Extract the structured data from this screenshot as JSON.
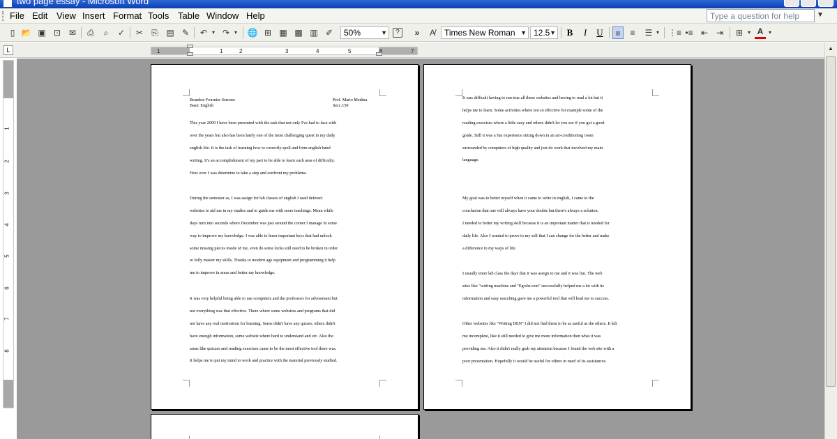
{
  "window": {
    "title": "two page essay - Microsoft Word"
  },
  "menubar": {
    "items": [
      "File",
      "Edit",
      "View",
      "Insert",
      "Format",
      "Tools",
      "Table",
      "Window",
      "Help"
    ],
    "ask_placeholder": "Type a question for help"
  },
  "toolbar": {
    "zoom": "50%",
    "font": "Times New Roman",
    "size": "12.5",
    "bold": "B",
    "italic": "I",
    "underline": "U",
    "font_color": "A",
    "help_glyph": "?",
    "overflow": "»",
    "colors": {
      "font_color_underline": "#e00000"
    }
  },
  "ruler": {
    "tab_selector": "L",
    "h_ticks": [
      "1",
      "1",
      "2",
      "3",
      "4",
      "5",
      "6",
      "7"
    ],
    "v_ticks": [
      "1",
      "2",
      "3",
      "4",
      "5",
      "6",
      "7",
      "8"
    ]
  },
  "page1": {
    "name_left": "Brandon Fournier Serrano",
    "course_left": "Basic English",
    "name_right": "Prof. Mario Medina",
    "course_right": "Secc.150",
    "p1": [
      " This year 2009 I have been presented with the task that not only I've had to face with",
      "over the years but also has been lately one of the most challenging  quest  in my daily",
      "english life. It is the task of learning how to correctly spell and form english hand",
      "writing. It's an accomplishment of my part to be able to learn such area of difficulty.",
      "How ever I was determine to take a step and confront my problems."
    ],
    "p2": [
      " During the semester as, I was assign for lab classes of english I used deferect",
      "websites to aid me in my studies and to guide me with more teachings. Mean while",
      "days turn into seconds where December was just around the corner I manage in some",
      "way to improve my knowledge. I was able to learn important keys that had unlock",
      "some missing pieces inside of me, even do some locks still need to be broken in order",
      "to fully master my skills. Thanks to modern age equipment and programming it help",
      "me to improve in areas and better my knowledge."
    ],
    "p3": [
      " It was very helpful being able to use computers and the professors for advisement but",
      "not everything was that effective. There where some websites and programs that did",
      "not have any real motivation for learning. Some didn't have any quizes; others didn't",
      "have enough information, some website where hard to understand and etc. Also  the",
      "areas like quizzes and reading exercises came to be the most effective tool there was.",
      "It helps me to put my mind to work and practice with the material previously studied."
    ]
  },
  "page2": {
    "p1": [
      " It was difficult having to run true all these websites and having to read a lot but it",
      "helps me to learn. Some activities where not so effective for example some of the",
      "reading exercises where a little easy and others didn't let you see if you got a good",
      "grade. Still it was a fun experience sitting down in an air-conditioning room",
      "surrounded by computers of high quality and just do work that involved my main",
      "language."
    ],
    "p2": [
      "My goal was to better myself when it came to write in english, I came to the",
      "conclusion that one will always have your doubts but there's always a solution.",
      "I needed to better my writing skill because it is an  important matter that is needed for",
      "daily life. Also I wanted to prove to my self that I can change for the better and make",
      "a difference to my ways of life."
    ],
    "p3": [
      " I usually enter lab class the days that it was assign to me and it was fun. The web",
      "sites like \"writing machine and \"Ego4u.com\" successfully helped me a lot with its",
      "information and easy searching gave me a powerful tool that will lead me to success."
    ],
    "p4": [
      "Other websites like \"Writing DEN\" I did not find them to be as useful as the others. It left",
      "me incomplete, like it still needed to give me more information then what it was",
      "providing me. Also it didn't really grab my attention because I found the web site with a",
      "poor presentation. Hopefully it would be useful for others in need of its assistances."
    ]
  }
}
